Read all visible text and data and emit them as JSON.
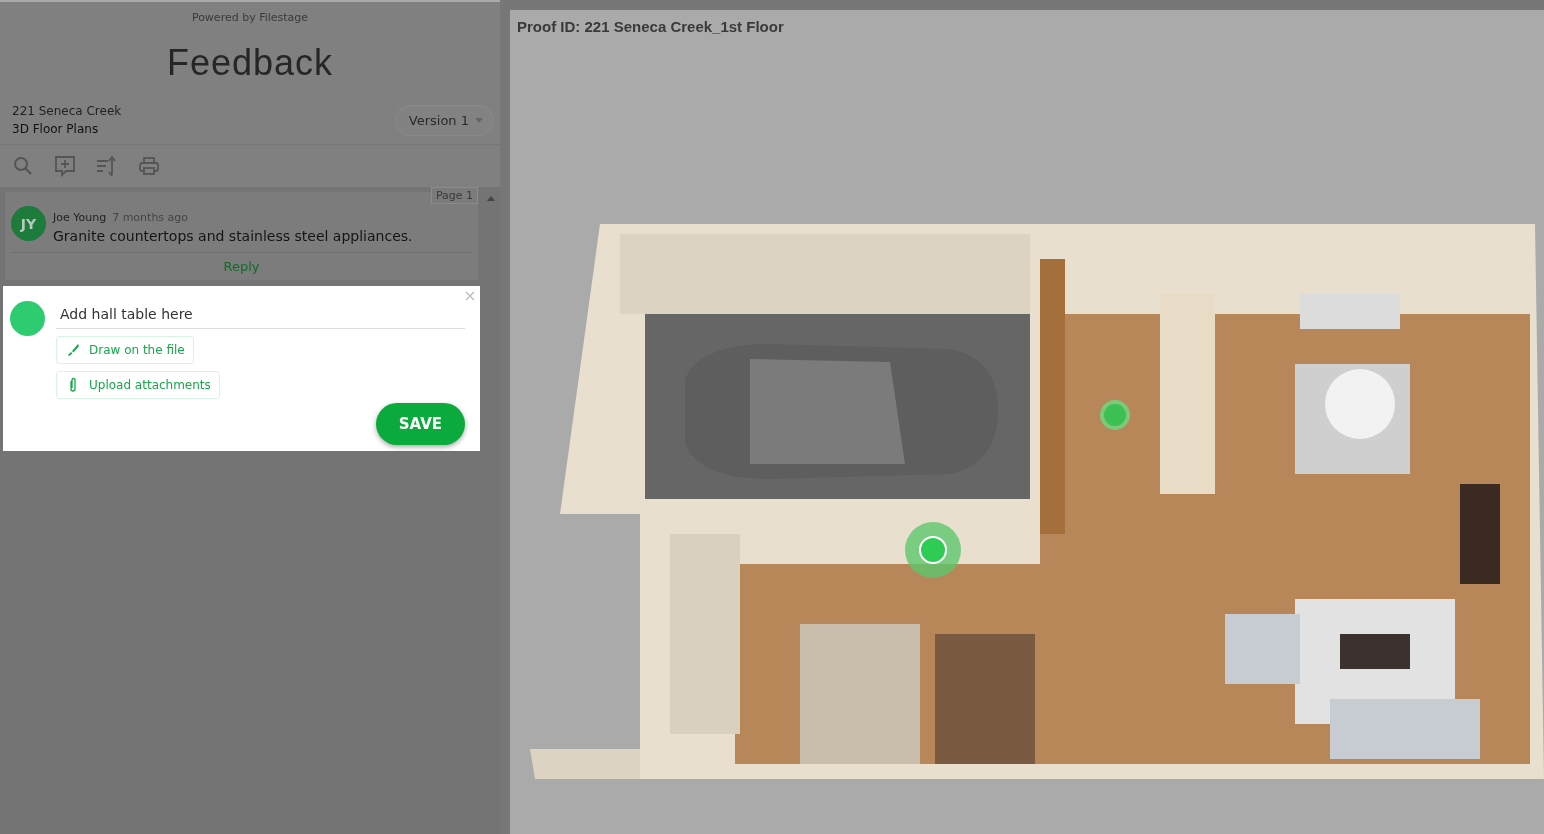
{
  "powered_by": "Powered by Filestage",
  "title": "Feedback",
  "project": {
    "name": "221 Seneca Creek",
    "subtitle": "3D Floor Plans"
  },
  "version": {
    "label": "Version 1"
  },
  "page_tag": "Page 1",
  "comments": [
    {
      "initials": "JY",
      "author": "Joe Young",
      "time": "7 months ago",
      "text": "Granite countertops and stainless steel appliances.",
      "reply": "Reply"
    }
  ],
  "new_comment": {
    "value": "Add hall table here",
    "actions": [
      {
        "kind": "draw",
        "label": "Draw on the file"
      },
      {
        "kind": "attach",
        "label": "Upload attachments"
      }
    ],
    "save": "SAVE"
  },
  "proof": {
    "title": "Proof ID: 221 Seneca Creek_1st Floor"
  }
}
